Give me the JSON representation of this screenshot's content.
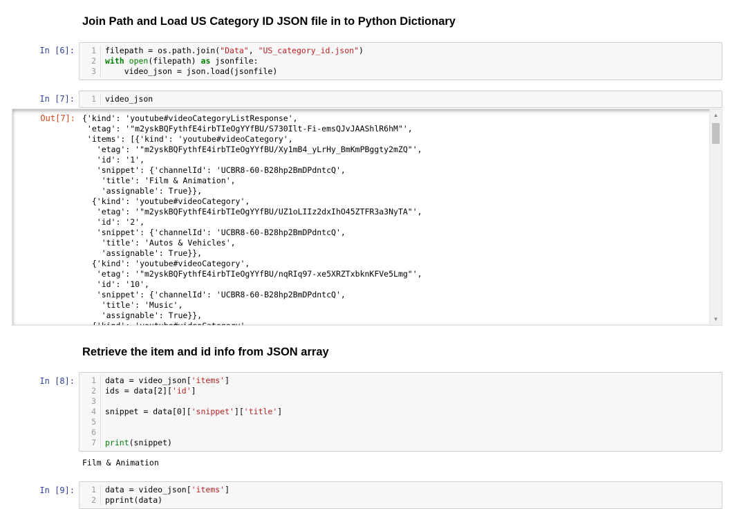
{
  "headings": {
    "h1": "Join Path and Load US Category ID JSON file in to Python Dictionary",
    "h2": "Retrieve the item and id info from JSON array"
  },
  "cells": {
    "c6": {
      "prompt": "In [6]:",
      "lines": [
        {
          "n": "1",
          "code": "filepath = os.path.join(\"Data\", \"US_category_id.json\")"
        },
        {
          "n": "2",
          "code": "with open(filepath) as jsonfile:"
        },
        {
          "n": "3",
          "code": "    video_json = json.load(jsonfile)"
        }
      ]
    },
    "c7": {
      "prompt": "In [7]:",
      "lines": [
        {
          "n": "1",
          "code": "video_json"
        }
      ],
      "out_prompt": "Out[7]:",
      "output": "{'kind': 'youtube#videoCategoryListResponse',\n 'etag': '\"m2yskBQFythfE4irbTIeOgYYfBU/S730Ilt-Fi-emsQJvJAAShlR6hM\"',\n 'items': [{'kind': 'youtube#videoCategory',\n   'etag': '\"m2yskBQFythfE4irbTIeOgYYfBU/Xy1mB4_yLrHy_BmKmPBggty2mZQ\"',\n   'id': '1',\n   'snippet': {'channelId': 'UCBR8-60-B28hp2BmDPdntcQ',\n    'title': 'Film & Animation',\n    'assignable': True}},\n  {'kind': 'youtube#videoCategory',\n   'etag': '\"m2yskBQFythfE4irbTIeOgYYfBU/UZ1oLIIz2dxIhO45ZTFR3a3NyTA\"',\n   'id': '2',\n   'snippet': {'channelId': 'UCBR8-60-B28hp2BmDPdntcQ',\n    'title': 'Autos & Vehicles',\n    'assignable': True}},\n  {'kind': 'youtube#videoCategory',\n   'etag': '\"m2yskBQFythfE4irbTIeOgYYfBU/nqRIq97-xe5XRZTxbknKFVe5Lmg\"',\n   'id': '10',\n   'snippet': {'channelId': 'UCBR8-60-B28hp2BmDPdntcQ',\n    'title': 'Music',\n    'assignable': True}},\n  {'kind': 'youtube#videoCategory',"
    },
    "c8": {
      "prompt": "In [8]:",
      "lines": [
        {
          "n": "1",
          "code": "data = video_json['items']"
        },
        {
          "n": "2",
          "code": "ids = data[2]['id']"
        },
        {
          "n": "3",
          "code": ""
        },
        {
          "n": "4",
          "code": "snippet = data[0]['snippet']['title']"
        },
        {
          "n": "5",
          "code": ""
        },
        {
          "n": "6",
          "code": ""
        },
        {
          "n": "7",
          "code": "print(snippet)"
        }
      ],
      "output": "Film & Animation"
    },
    "c9": {
      "prompt": "In [9]:",
      "lines": [
        {
          "n": "1",
          "code": "data = video_json['items']"
        },
        {
          "n": "2",
          "code": "pprint(data)"
        }
      ]
    }
  },
  "colors": {
    "in_prompt": "#303f9f",
    "out_prompt": "#d84315",
    "keyword": "#008000",
    "string": "#ba2121"
  }
}
